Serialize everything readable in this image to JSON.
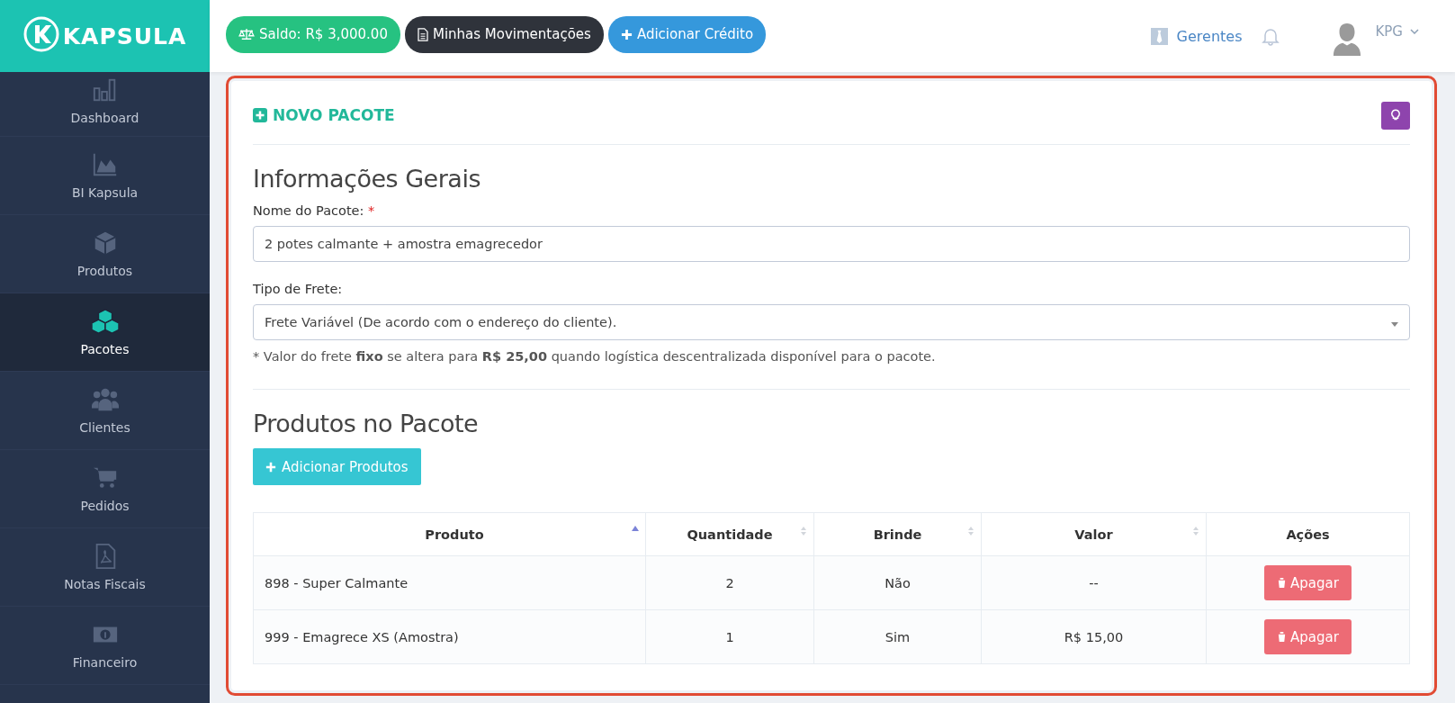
{
  "logo": {
    "text": "KAPSULA"
  },
  "topbar": {
    "buttons": [
      {
        "kind": "balance",
        "label": "Saldo: R$ 3,000.00"
      },
      {
        "kind": "statement",
        "label": "Minhas Movimentações"
      },
      {
        "kind": "add",
        "label": "Adicionar Crédito"
      }
    ],
    "managers_link": "Gerentes",
    "user": "KPG"
  },
  "sidebar": {
    "items": [
      {
        "label": "Dashboard",
        "selected": false
      },
      {
        "label": "BI Kapsula",
        "selected": false
      },
      {
        "label": "Produtos",
        "selected": false
      },
      {
        "label": "Pacotes",
        "selected": true
      },
      {
        "label": "Clientes",
        "selected": false
      },
      {
        "label": "Pedidos",
        "selected": false
      },
      {
        "label": "Notas Fiscais",
        "selected": false
      },
      {
        "label": "Financeiro",
        "selected": false
      }
    ]
  },
  "card": {
    "title": "NOVO PACOTE",
    "section_1": {
      "heading": "Informações Gerais",
      "name_label": "Nome do Pacote:",
      "required_mark": "*",
      "name_value": "2 potes calmante + amostra emagrecedor",
      "freight_label": "Tipo de Frete:",
      "freight_value": "Frete Variável (De acordo com o endereço do cliente).",
      "note": "* Valor do frete **fixo** se altera para **R$ 25,00** quando logística descentralizada disponível para o pacote."
    },
    "section_2": {
      "heading": "Produtos no Pacote",
      "add_button": "Adicionar Produtos",
      "table": {
        "columns": [
          {
            "label": "Produto",
            "kind": "sorted"
          },
          {
            "label": "Quantidade",
            "kind": "sortable"
          },
          {
            "label": "Brinde",
            "kind": "sortable"
          },
          {
            "label": "Valor",
            "kind": "sortable"
          },
          {
            "label": "Ações",
            "kind": "plain"
          }
        ],
        "rows": [
          {
            "cells": [
              "898 - Super Calmante",
              "2",
              "Não",
              "--"
            ],
            "action": "Apagar"
          },
          {
            "cells": [
              "999 - Emagrece XS (Amostra)",
              "1",
              "Sim",
              "R$ 15,00"
            ],
            "action": "Apagar"
          }
        ]
      }
    }
  }
}
